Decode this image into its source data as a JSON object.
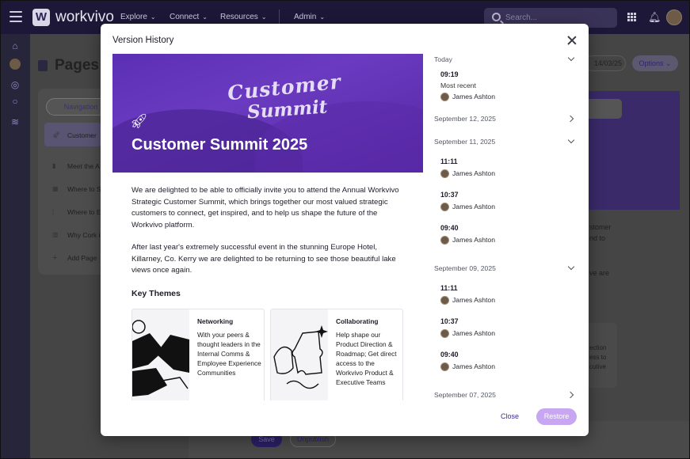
{
  "app": {
    "name": "workvivo",
    "logo_letter": "W",
    "nav": [
      {
        "label": "Explore"
      },
      {
        "label": "Connect"
      },
      {
        "label": "Resources"
      },
      {
        "label": "Admin"
      }
    ],
    "search_placeholder": "Search..."
  },
  "background_page": {
    "title": "Pages",
    "navigation_tab": "Navigation",
    "pages": [
      {
        "label": "Customer"
      },
      {
        "label": "Meet the A"
      },
      {
        "label": "Where to S"
      },
      {
        "label": "Where to E"
      },
      {
        "label": "Why Cork i"
      },
      {
        "label": "Add Page"
      }
    ],
    "date_partial": "14/03/25",
    "options_label": "Options",
    "text_fragments": [
      "stomer",
      "nd to",
      "ve are"
    ],
    "card_fragments": [
      "ection",
      "ess to",
      "cutive"
    ],
    "save_label": "Save",
    "unpublish_label": "Unpublish"
  },
  "modal": {
    "title": "Version History",
    "preview": {
      "hero_script_line1": "Customer",
      "hero_script_line2": "Summit",
      "hero_title": "Customer Summit 2025",
      "paragraph1": "We are delighted to be able to officially invite you to attend the Annual Workvivo Strategic Customer Summit, which brings together our most valued strategic customers to connect, get inspired, and to help us shape the future of the Workvivo platform.",
      "paragraph2": "After last year's extremely successful event in the stunning Europe Hotel, Killarney, Co. Kerry we are delighted to be returning to see those beautiful lake views once again.",
      "key_themes": "Key Themes",
      "cards": [
        {
          "title": "Networking",
          "body": "With your peers & thought leaders in the Internal Comms & Employee Experience Communities"
        },
        {
          "title": "Collaborating",
          "body": "Help shape our Product Direction & Roadmap; Get direct access to the Workvivo Product & Executive Teams"
        }
      ]
    },
    "history": {
      "today_label": "Today",
      "today_entry": {
        "time": "09:19",
        "note": "Most recent",
        "user": "James Ashton"
      },
      "sep12_label": "September 12, 2025",
      "sep11_label": "September 11, 2025",
      "sep11_entries": [
        {
          "time": "11:11",
          "user": "James Ashton"
        },
        {
          "time": "10:37",
          "user": "James Ashton"
        },
        {
          "time": "09:40",
          "user": "James Ashton"
        }
      ],
      "sep09_label": "September 09, 2025",
      "sep09_entries": [
        {
          "time": "11:11",
          "user": "James Ashton"
        },
        {
          "time": "10:37",
          "user": "James Ashton"
        },
        {
          "time": "09:40",
          "user": "James Ashton"
        }
      ],
      "sep07_label": "September 07, 2025"
    },
    "close_label": "Close",
    "restore_label": "Restore"
  },
  "colors": {
    "brand_dark": "#1d1838",
    "accent_purple": "#5b2fb4",
    "restore_disabled": "#c7a6f2",
    "link_purple": "#3b2d8f"
  }
}
